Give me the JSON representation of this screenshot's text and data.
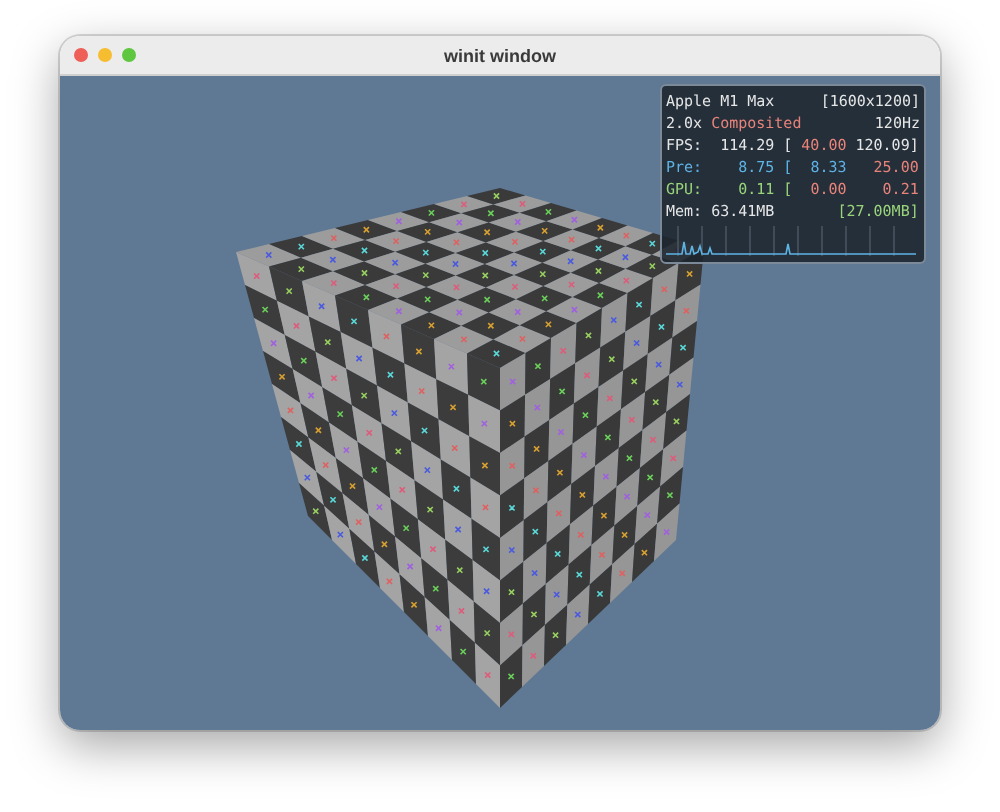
{
  "window": {
    "title": "winit window"
  },
  "stats": {
    "device": "Apple M1 Max",
    "resolution": "[1600x1200]",
    "scale": "2.0x",
    "compositing": "Composited",
    "refresh": "120Hz",
    "metrics": [
      {
        "label": {
          "text": "FPS:",
          "color": "#e6e6e6"
        },
        "value": {
          "text": "114.29",
          "color": "#e6e6e6"
        },
        "open": {
          "text": "[",
          "color": "#e6e6e6"
        },
        "min": {
          "text": "40.00",
          "color": "#e8837a"
        },
        "max": {
          "text": "120.09]",
          "color": "#e6e6e6"
        }
      },
      {
        "label": {
          "text": "Pre:",
          "color": "#5fb4e6"
        },
        "value": {
          "text": "8.75",
          "color": "#5fb4e6"
        },
        "open": {
          "text": "[",
          "color": "#5fb4e6"
        },
        "min": {
          "text": "8.33",
          "color": "#5fb4e6"
        },
        "max": {
          "text": "25.00",
          "color": "#e8837a"
        }
      },
      {
        "label": {
          "text": "GPU:",
          "color": "#9ad47a"
        },
        "value": {
          "text": "0.11",
          "color": "#9ad47a"
        },
        "open": {
          "text": "[",
          "color": "#9ad47a"
        },
        "min": {
          "text": "0.00",
          "color": "#e8837a"
        },
        "max": {
          "text": "0.21",
          "color": "#e8837a"
        }
      },
      {
        "label": {
          "text": "Mem:",
          "color": "#e6e6e6"
        },
        "value": {
          "text": "63.41MB",
          "color": "#e6e6e6"
        },
        "max": {
          "text": "[27.00MB]",
          "color": "#9ad47a"
        }
      }
    ]
  }
}
